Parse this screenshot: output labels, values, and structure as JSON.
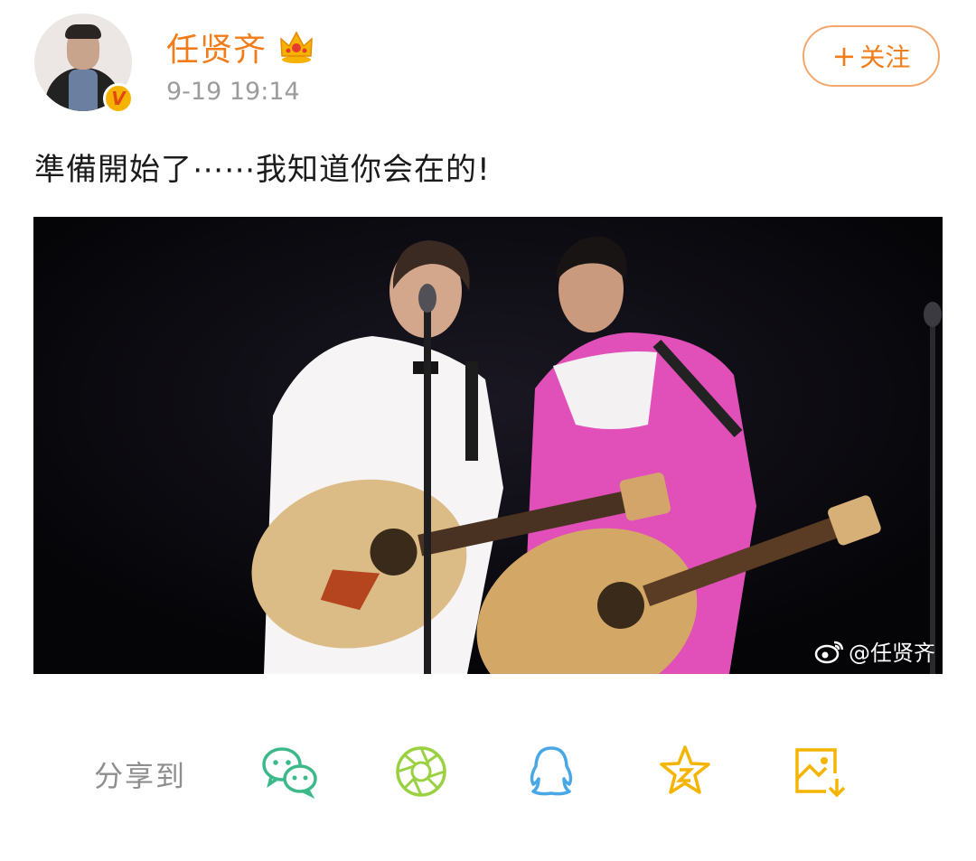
{
  "post": {
    "username": "任贤齐",
    "timestamp": "9-19 19:14",
    "text": "準備開始了⋯⋯我知道你会在的!",
    "verified_badge": "V"
  },
  "follow_button": {
    "plus": "+",
    "label": "关注"
  },
  "video": {
    "watermark": "@任贤齐"
  },
  "share": {
    "label": "分享到",
    "targets": [
      {
        "name": "wechat-icon",
        "color": "#3cb98a"
      },
      {
        "name": "moments-icon",
        "color": "#9ad141"
      },
      {
        "name": "qq-icon",
        "color": "#4aa7e6"
      },
      {
        "name": "favorite-icon",
        "color": "#f5b400"
      },
      {
        "name": "save-image-icon",
        "color": "#f5b400"
      }
    ]
  },
  "colors": {
    "accent": "#f07d1a",
    "follow_border": "#f3a76c",
    "timestamp": "#9c9c9c"
  }
}
